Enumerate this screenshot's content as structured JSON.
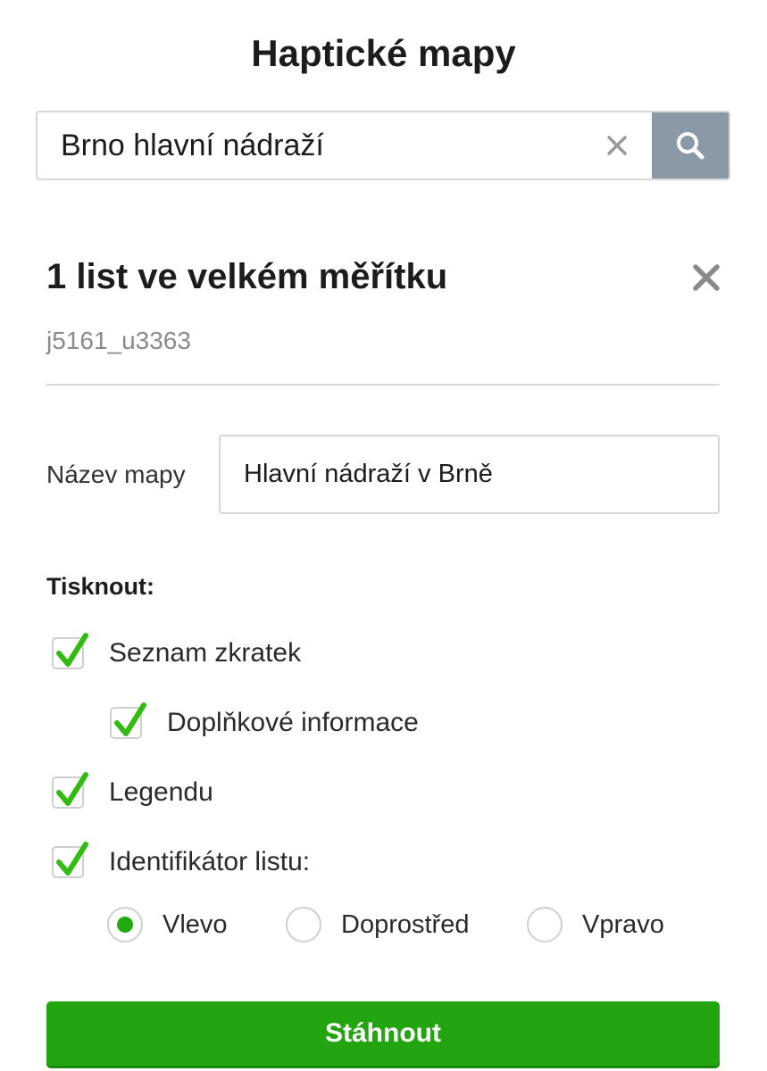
{
  "app": {
    "title": "Haptické mapy"
  },
  "search": {
    "value": "Brno hlavní nádraží",
    "clear_icon": "close-icon",
    "search_icon": "search-icon"
  },
  "sheet": {
    "title": "1 list ve velkém měřítku",
    "id": "j5161_u3363"
  },
  "form": {
    "map_name_label": "Název mapy",
    "map_name_value": "Hlavní nádraží v Brně",
    "print_heading": "Tisknout:",
    "checkboxes": [
      {
        "label": "Seznam zkratek",
        "checked": true
      },
      {
        "label": "Doplňkové informace",
        "checked": true
      },
      {
        "label": "Legendu",
        "checked": true
      },
      {
        "label": "Identifikátor listu:",
        "checked": true
      }
    ],
    "identifier_position": {
      "options": [
        "Vlevo",
        "Doprostřed",
        "Vpravo"
      ],
      "selected": "Vlevo"
    },
    "download_label": "Stáhnout"
  },
  "colors": {
    "accent_green": "#22a511",
    "check_green": "#33bb11",
    "search_button": "#8a99a5"
  }
}
